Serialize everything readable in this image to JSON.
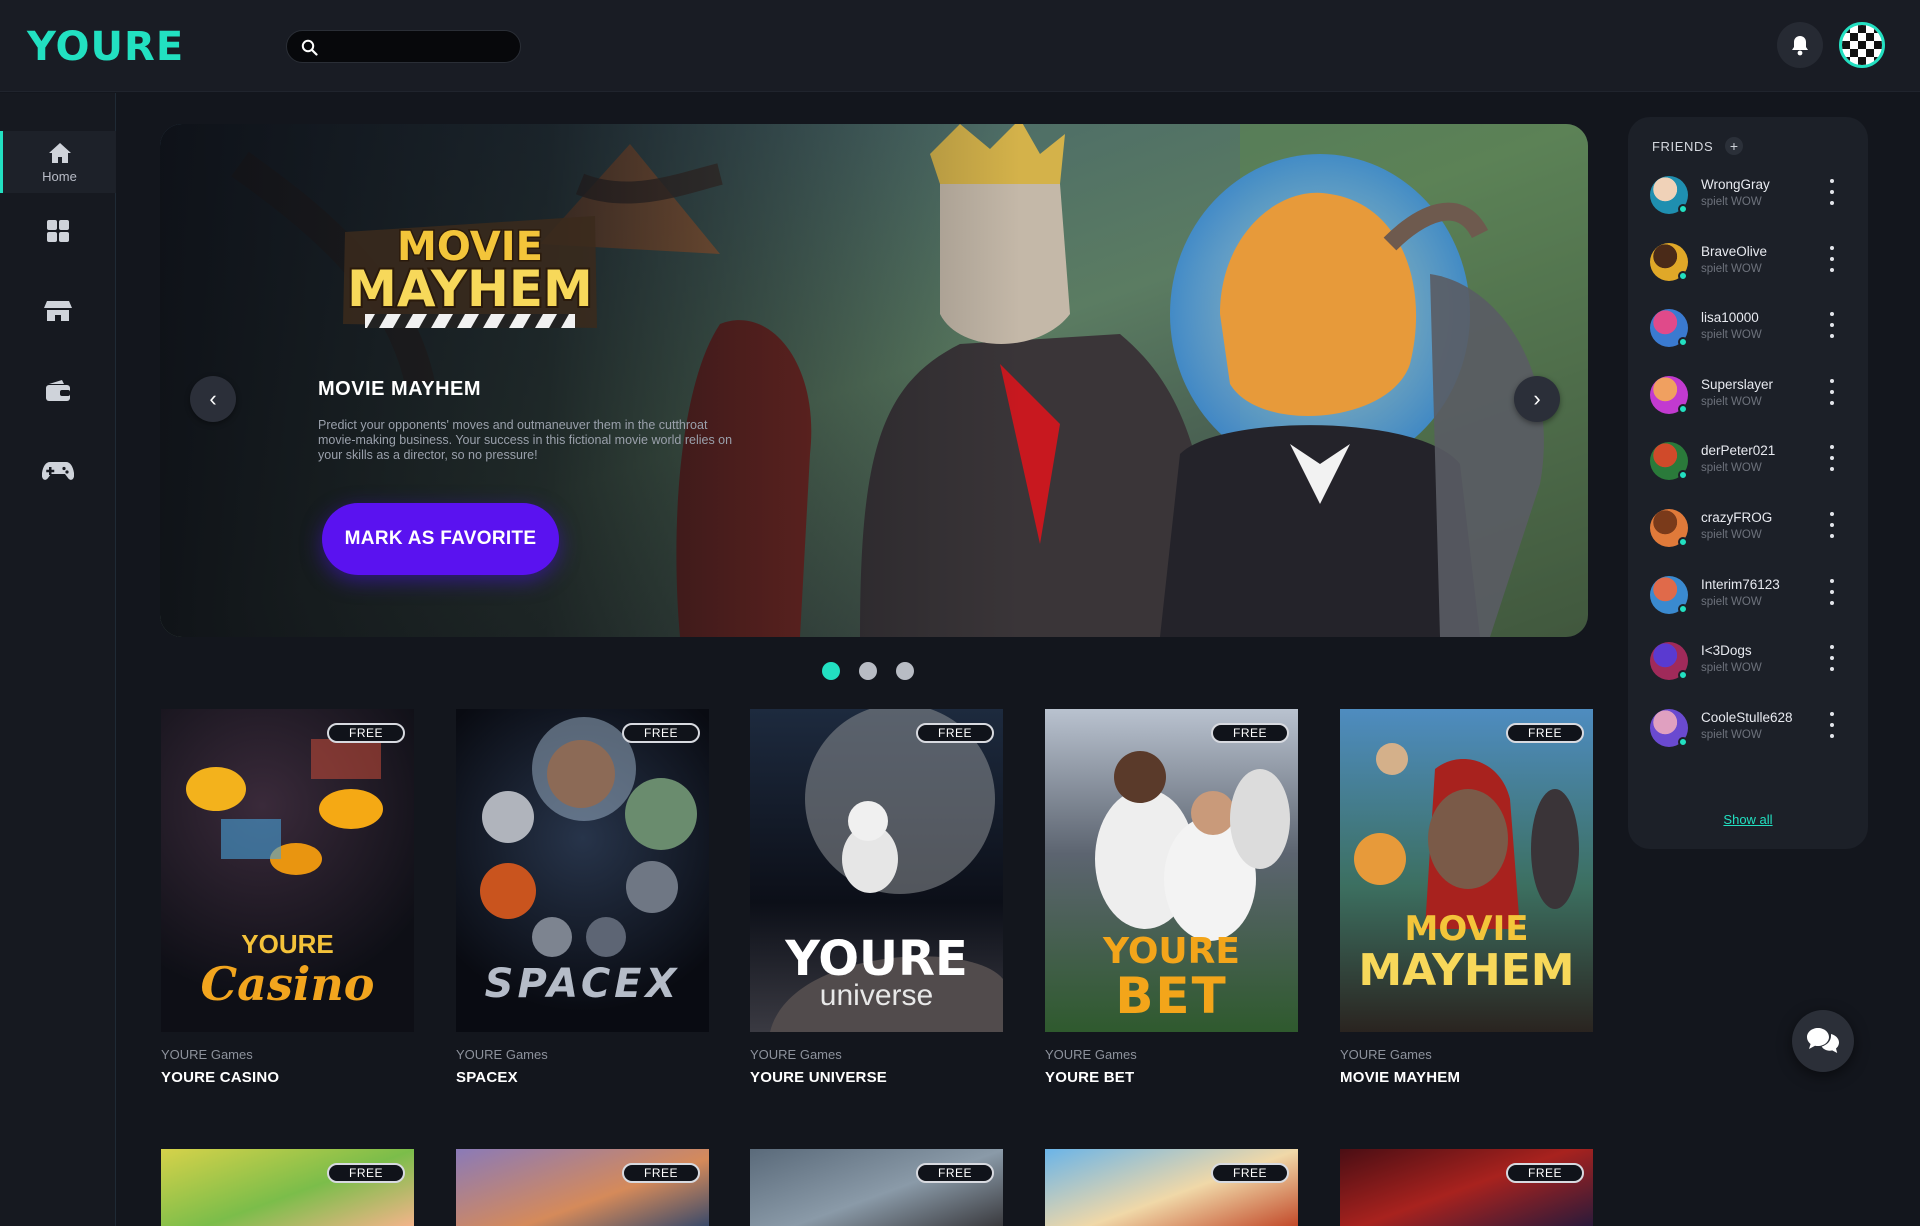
{
  "header": {
    "logo": "YOURE",
    "search_placeholder": "",
    "icons": [
      "search-icon",
      "bell-icon",
      "checkered-avatar"
    ]
  },
  "sidebar": {
    "items": [
      {
        "label": "Home",
        "icon": "home-icon",
        "active": true
      },
      {
        "label": "",
        "icon": "grid-icon",
        "active": false
      },
      {
        "label": "",
        "icon": "store-icon",
        "active": false
      },
      {
        "label": "",
        "icon": "wallet-icon",
        "active": false
      },
      {
        "label": "",
        "icon": "gamepad-icon",
        "active": false
      }
    ]
  },
  "hero": {
    "logo_line1": "MOVIE",
    "logo_line2": "MAYHEM",
    "title": "MOVIE MAYHEM",
    "description": "Predict your opponents' moves and outmaneuver them in the cutthroat movie-making business. Your success in this fictional movie world relies on your skills as a director, so no pressure!",
    "button": "MARK AS FAVORITE",
    "slides_total": 3,
    "active_slide": 1
  },
  "games": [
    {
      "publisher": "YOURE Games",
      "title": "YOURE CASINO",
      "badge": "FREE",
      "art_top": "YOURE",
      "art_bottom": "Casino"
    },
    {
      "publisher": "YOURE Games",
      "title": "SPACEX",
      "badge": "FREE",
      "art_top": "",
      "art_bottom": "SPACEX"
    },
    {
      "publisher": "YOURE Games",
      "title": "YOURE UNIVERSE",
      "badge": "FREE",
      "art_top": "YOURE",
      "art_bottom": "universe"
    },
    {
      "publisher": "YOURE Games",
      "title": "YOURE BET",
      "badge": "FREE",
      "art_top": "YOURE",
      "art_bottom": "BET"
    },
    {
      "publisher": "YOURE Games",
      "title": "MOVIE MAYHEM",
      "badge": "FREE",
      "art_top": "MOVIE",
      "art_bottom": "MAYHEM"
    }
  ],
  "games_row2": [
    {
      "badge": "FREE"
    },
    {
      "badge": "FREE"
    },
    {
      "badge": "FREE"
    },
    {
      "badge": "FREE"
    },
    {
      "badge": "FREE"
    }
  ],
  "friends": {
    "title": "FRIENDS",
    "add_label": "+",
    "show_all": "Show all",
    "list": [
      {
        "name": "WrongGray",
        "status": "spielt WOW"
      },
      {
        "name": "BraveOlive",
        "status": "spielt WOW"
      },
      {
        "name": "lisa10000",
        "status": "spielt WOW"
      },
      {
        "name": "Superslayer",
        "status": "spielt WOW"
      },
      {
        "name": "derPeter021",
        "status": "spielt WOW"
      },
      {
        "name": "crazyFROG",
        "status": "spielt WOW"
      },
      {
        "name": "Interim76123",
        "status": "spielt WOW"
      },
      {
        "name": "I<3Dogs",
        "status": "spielt WOW"
      },
      {
        "name": "CooleStulle628",
        "status": "spielt WOW"
      }
    ]
  },
  "colors": {
    "accent": "#22e0c1",
    "button": "#5a12f0",
    "background": "#13161d",
    "panel": "#1c2028"
  }
}
